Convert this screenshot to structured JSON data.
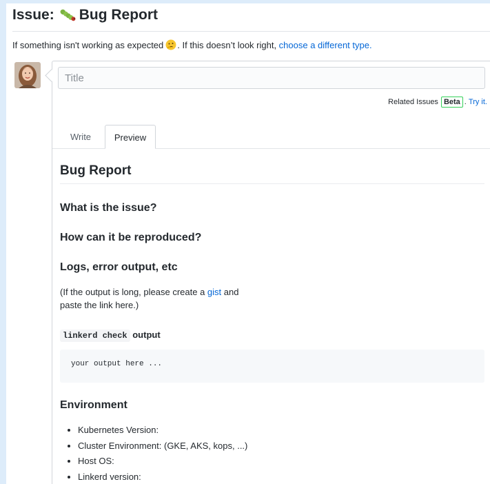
{
  "header": {
    "prefix": "Issue:",
    "bug_icon": "caterpillar-icon",
    "title": "Bug Report"
  },
  "subtitle": {
    "before": "If something isn't working as expected",
    "emoji_icon": "thinking-face-icon",
    "middle": ". If this doesn’t look right, ",
    "link": "choose a different type."
  },
  "form": {
    "title_placeholder": "Title",
    "related_label": "Related Issues",
    "beta_badge": "Beta",
    "try_it": "Try it.",
    "tabs": [
      {
        "label": "Write",
        "active": false
      },
      {
        "label": "Preview",
        "active": true
      }
    ]
  },
  "preview": {
    "h1": "Bug Report",
    "q1": "What is the issue?",
    "q2": "How can it be reproduced?",
    "q3": "Logs, error output, etc",
    "logs_text_1": "(If the output is long, please create a ",
    "logs_link": "gist",
    "logs_text_2": " and",
    "logs_text_3": "paste the link here.)",
    "check_code": "linkerd check",
    "check_suffix": " output",
    "code_block": "your output here ...",
    "env_heading": "Environment",
    "env_items": [
      "Kubernetes Version:",
      "Cluster Environment: (GKE, AKS, kops, ...)",
      "Host OS:",
      "Linkerd version:"
    ]
  },
  "colors": {
    "link": "#0366d6",
    "beta_border": "#34d058",
    "background_outer": "#ddecfa"
  }
}
